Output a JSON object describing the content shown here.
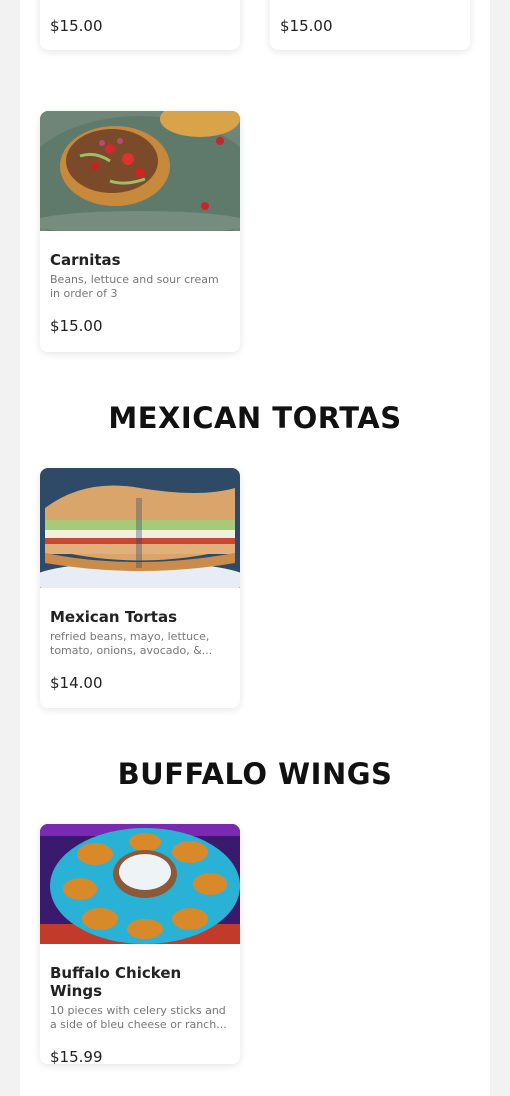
{
  "top_cards": [
    {
      "price": "$15.00"
    },
    {
      "price": "$15.00"
    }
  ],
  "cards": [
    {
      "title": "Carnitas",
      "description": "Beans, lettuce and sour cream in order of 3",
      "price": "$15.00"
    },
    {
      "title": "Mexican Tortas",
      "description": "refried beans, mayo, lettuce, tomato, onions, avocado, &...",
      "price": "$14.00"
    },
    {
      "title": "Buffalo Chicken Wings",
      "description": "10 pieces with celery sticks and a side of bleu cheese or ranch...",
      "price": "$15.99"
    }
  ],
  "sections": [
    {
      "title": "MEXICAN TORTAS"
    },
    {
      "title": "BUFFALO WINGS"
    }
  ],
  "images": [
    {
      "name": "carnitas-photo"
    },
    {
      "name": "tortas-photo"
    },
    {
      "name": "wings-photo"
    }
  ]
}
